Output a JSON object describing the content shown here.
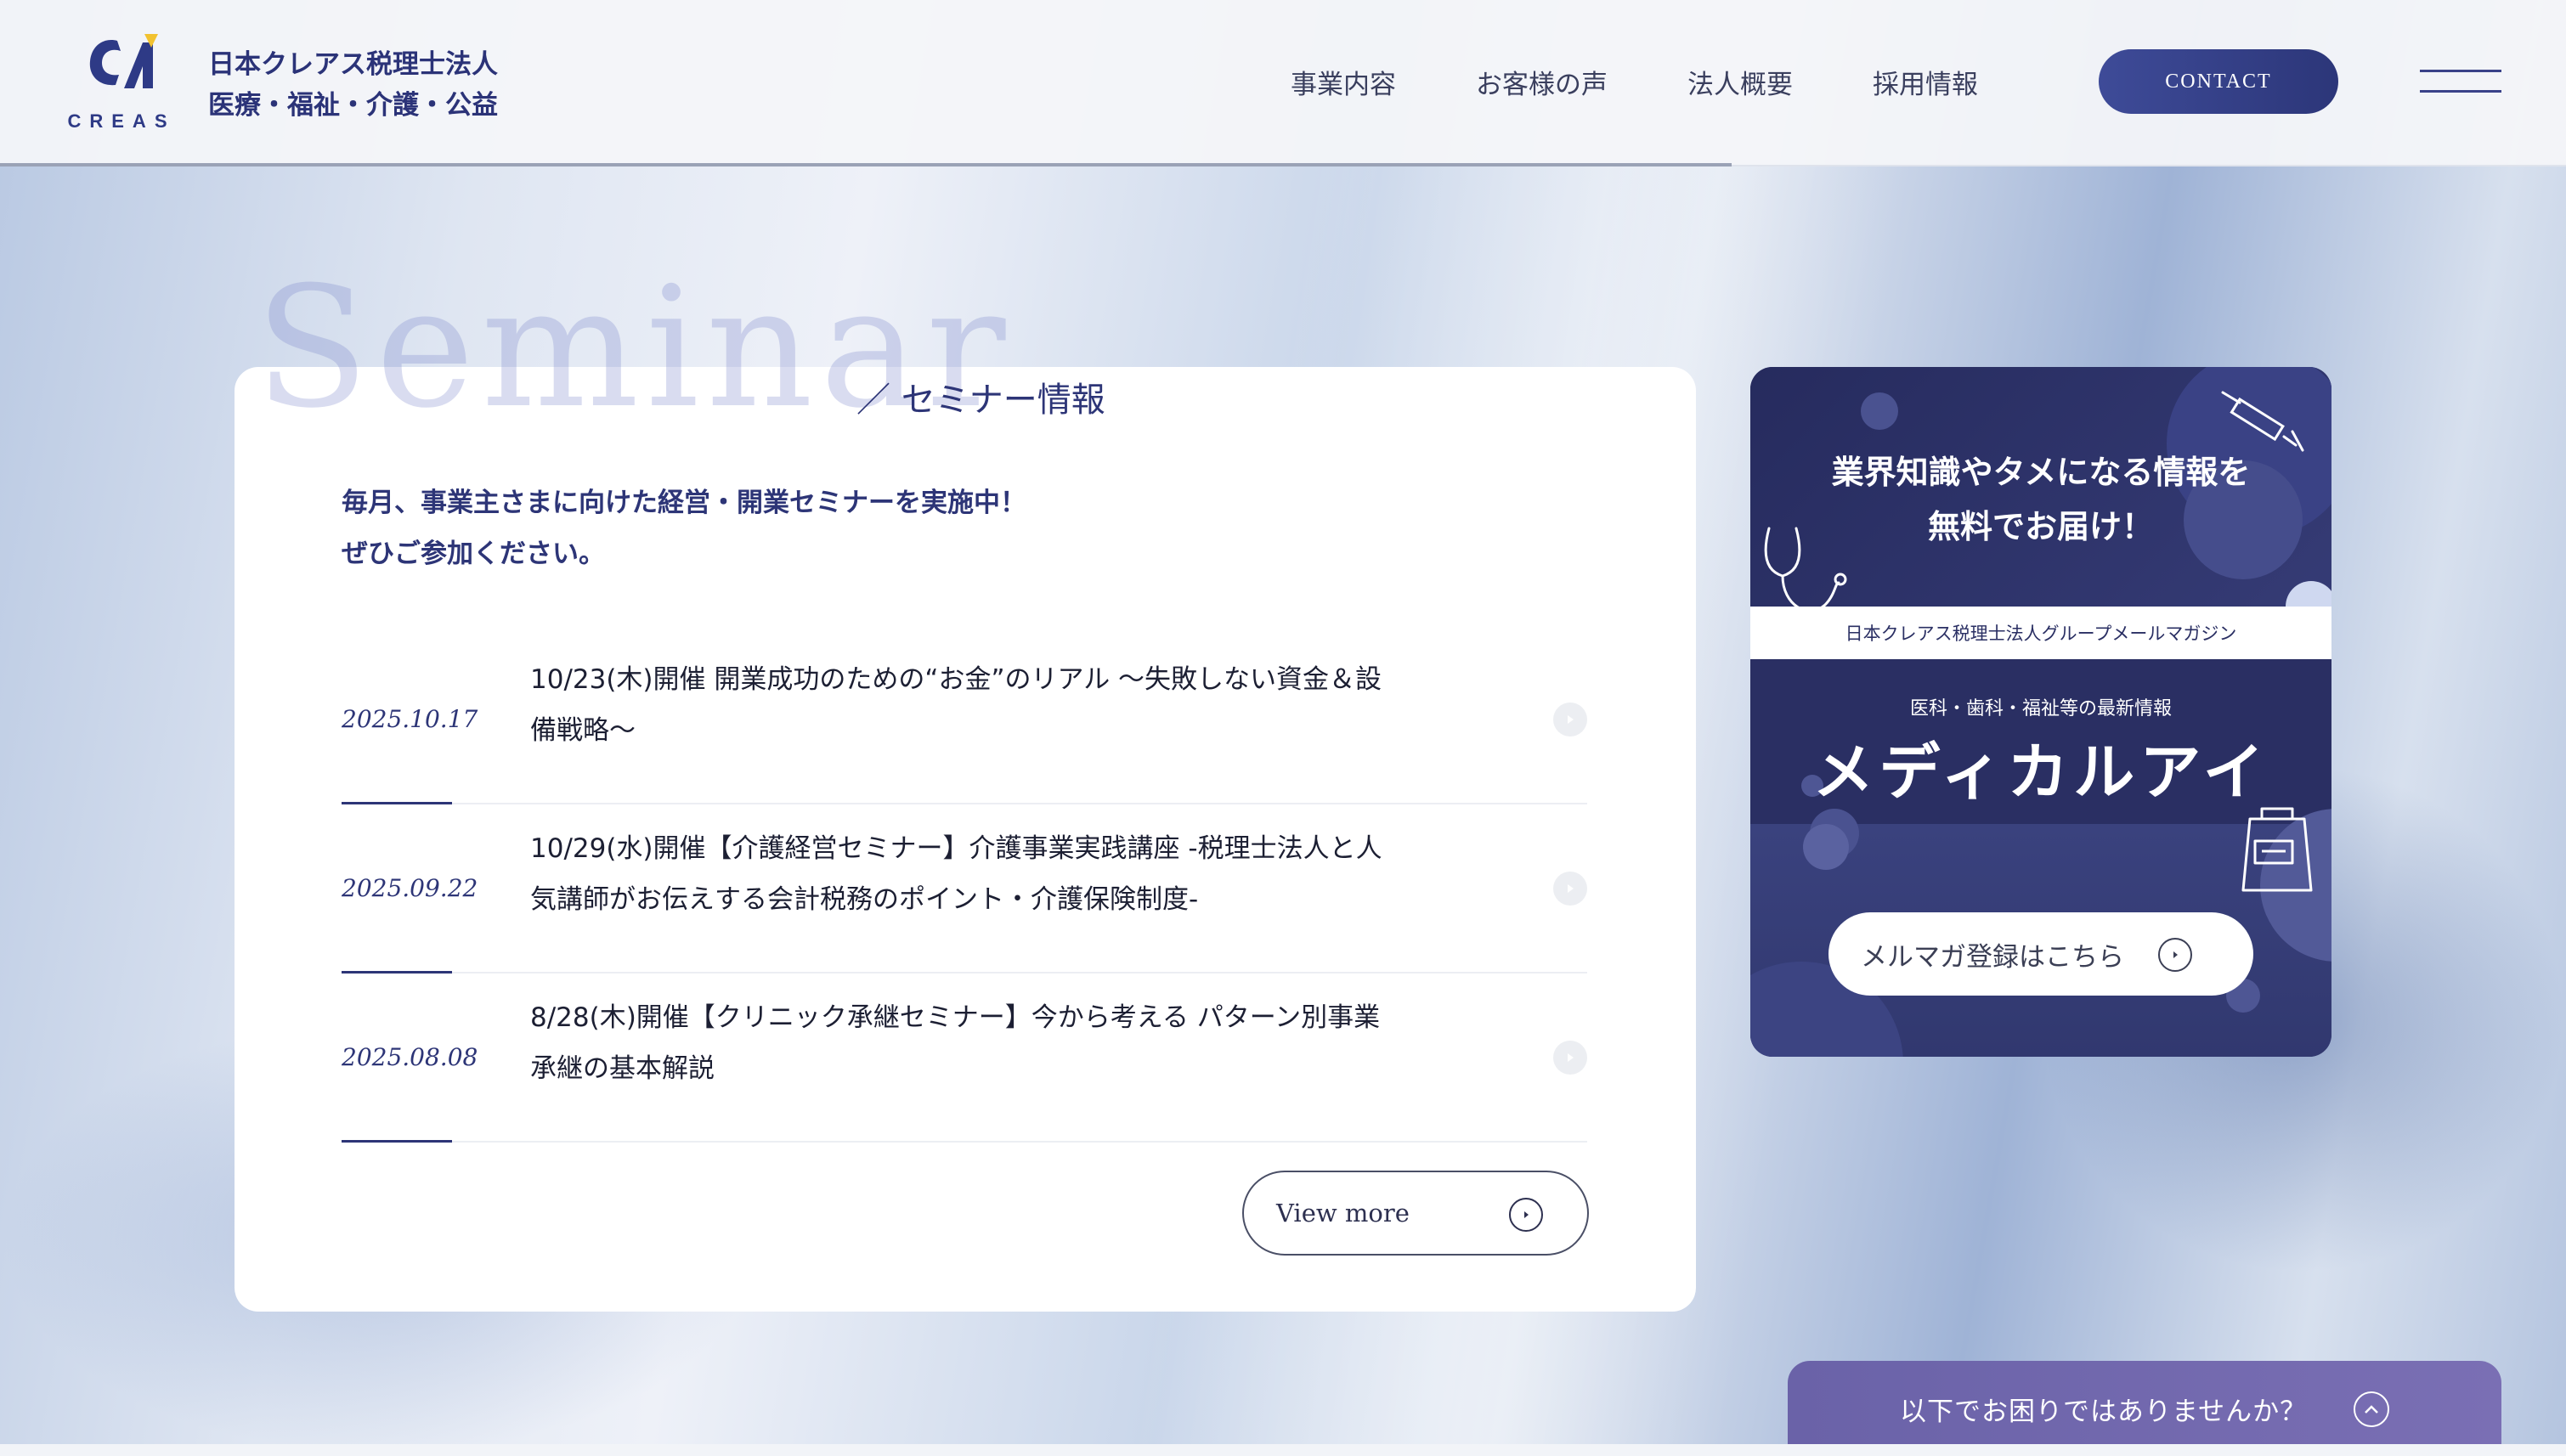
{
  "brand": {
    "logo_word": "CREAS",
    "name_line1": "日本クレアス税理士法人",
    "name_line2": "医療・福祉・介護・公益"
  },
  "nav": {
    "items": [
      {
        "label": "事業内容"
      },
      {
        "label": "お客様の声"
      },
      {
        "label": "法人概要"
      },
      {
        "label": "採用情報"
      }
    ],
    "contact_label": "CONTACT"
  },
  "seminar": {
    "heading_en": "Seminar",
    "heading_jp": "／ セミナー情報",
    "intro_line1": "毎月、事業主さまに向けた経営・開業セミナーを実施中！",
    "intro_line2": "ぜひご参加ください。",
    "items": [
      {
        "date": "2025.10.17",
        "title": "10/23(木)開催 開業成功のための“お金”のリアル 〜失敗しない資金＆設備戦略〜"
      },
      {
        "date": "2025.09.22",
        "title": "10/29(水)開催【介護経営セミナー】介護事業実践講座 -税理士法人と人気講師がお伝えする会計税務のポイント・介護保険制度-"
      },
      {
        "date": "2025.08.08",
        "title": "8/28(木)開催【クリニック承継セミナー】今から考える パターン別事業承継の基本解説"
      }
    ],
    "view_more_label": "View more"
  },
  "newsletter": {
    "headline_line1": "業界知識やタメになる情報を",
    "headline_line2": "無料でお届け！",
    "strip_text": "日本クレアス税理士法人グループメールマガジン",
    "sub_text": "医科・歯科・福祉等の最新情報",
    "title": "メディカルアイ",
    "button_label": "メルマガ登録はこちら"
  },
  "help": {
    "label": "以下でお困りではありませんか？"
  },
  "colors": {
    "brand_navy": "#2d3577",
    "accent_yellow": "#f2c230",
    "help_purple": "#6f67ad"
  }
}
